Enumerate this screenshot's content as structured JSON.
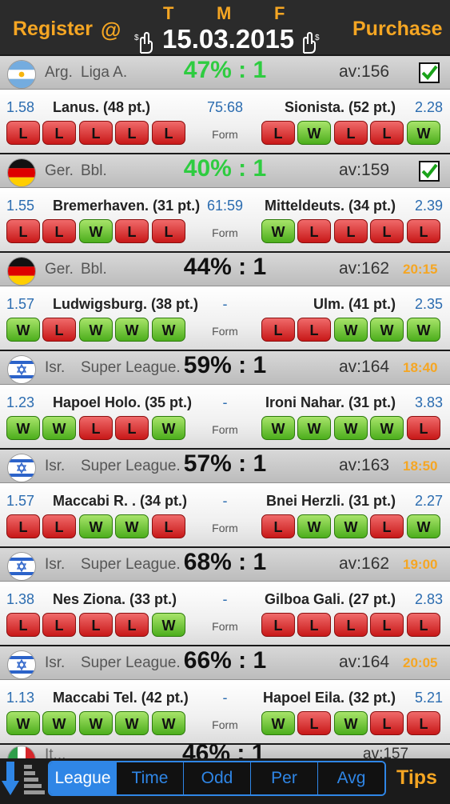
{
  "header": {
    "register": "Register",
    "at": "@",
    "purchase": "Purchase",
    "date": "15.03.2015",
    "letters": [
      "T",
      "M",
      "F"
    ]
  },
  "form_label": "Form",
  "matches": [
    {
      "country": "Arg.",
      "league": "Liga A.",
      "flag": "argentina",
      "pct": "47% : 1",
      "pct_color": "green",
      "av": "av:156",
      "checked": true,
      "time": "",
      "odd1": "1.58",
      "home": "Lanus. (48 pt.)",
      "score": "75:68",
      "away": "Sionista. (52 pt.)",
      "odd2": "2.28",
      "home_form": [
        "L",
        "L",
        "L",
        "L",
        "L"
      ],
      "away_form": [
        "L",
        "W",
        "L",
        "L",
        "W"
      ]
    },
    {
      "country": "Ger.",
      "league": "Bbl.",
      "flag": "germany",
      "pct": "40% : 1",
      "pct_color": "green",
      "av": "av:159",
      "checked": true,
      "time": "",
      "odd1": "1.55",
      "home": "Bremerhaven. (31 pt.)",
      "score": "61:59",
      "away": "Mitteldeuts. (34 pt.)",
      "odd2": "2.39",
      "home_form": [
        "L",
        "L",
        "W",
        "L",
        "L"
      ],
      "away_form": [
        "W",
        "L",
        "L",
        "L",
        "L"
      ]
    },
    {
      "country": "Ger.",
      "league": "Bbl.",
      "flag": "germany",
      "pct": "44% : 1",
      "pct_color": "black",
      "av": "av:162",
      "checked": false,
      "time": "20:15",
      "odd1": "1.57",
      "home": "Ludwigsburg. (38 pt.)",
      "score": "-",
      "away": "Ulm. (41 pt.)",
      "odd2": "2.35",
      "home_form": [
        "W",
        "L",
        "W",
        "W",
        "W"
      ],
      "away_form": [
        "L",
        "L",
        "W",
        "W",
        "W"
      ]
    },
    {
      "country": "Isr.",
      "league": "Super League.",
      "flag": "israel",
      "pct": "59% : 1",
      "pct_color": "black",
      "av": "av:164",
      "checked": false,
      "time": "18:40",
      "odd1": "1.23",
      "home": "Hapoel Holo. (35 pt.)",
      "score": "-",
      "away": "Ironi Nahar. (31 pt.)",
      "odd2": "3.83",
      "home_form": [
        "W",
        "W",
        "L",
        "L",
        "W"
      ],
      "away_form": [
        "W",
        "W",
        "W",
        "W",
        "L"
      ]
    },
    {
      "country": "Isr.",
      "league": "Super League.",
      "flag": "israel",
      "pct": "57% : 1",
      "pct_color": "black",
      "av": "av:163",
      "checked": false,
      "time": "18:50",
      "odd1": "1.57",
      "home": "Maccabi R. . (34 pt.)",
      "score": "-",
      "away": "Bnei Herzli. (31 pt.)",
      "odd2": "2.27",
      "home_form": [
        "L",
        "L",
        "W",
        "W",
        "L"
      ],
      "away_form": [
        "L",
        "W",
        "W",
        "L",
        "W"
      ]
    },
    {
      "country": "Isr.",
      "league": "Super League.",
      "flag": "israel",
      "pct": "68% : 1",
      "pct_color": "black",
      "av": "av:162",
      "checked": false,
      "time": "19:00",
      "odd1": "1.38",
      "home": "Nes Ziona. (33 pt.)",
      "score": "-",
      "away": "Gilboa Gali. (27 pt.)",
      "odd2": "2.83",
      "home_form": [
        "L",
        "L",
        "L",
        "L",
        "W"
      ],
      "away_form": [
        "L",
        "L",
        "L",
        "L",
        "L"
      ]
    },
    {
      "country": "Isr.",
      "league": "Super League.",
      "flag": "israel",
      "pct": "66% : 1",
      "pct_color": "black",
      "av": "av:164",
      "checked": false,
      "time": "20:05",
      "odd1": "1.13",
      "home": "Maccabi Tel. (42 pt.)",
      "score": "-",
      "away": "Hapoel Eila. (32 pt.)",
      "odd2": "5.21",
      "home_form": [
        "W",
        "W",
        "W",
        "W",
        "W"
      ],
      "away_form": [
        "W",
        "L",
        "W",
        "L",
        "L"
      ]
    }
  ],
  "peek": {
    "text": "It...",
    "pct": "46% : 1",
    "av": "av:157",
    "flag": "italy"
  },
  "tabs": [
    "League",
    "Time",
    "Odd",
    "Per",
    "Avg"
  ],
  "active_tab": "League",
  "tips": "Tips",
  "colors": {
    "accent": "#f5a623",
    "tab_blue": "#2f86e6",
    "green_pct": "#2ecc40",
    "odd_blue": "#2b6cb0",
    "loss_red": "#c81818",
    "win_green": "#4cae1c"
  }
}
